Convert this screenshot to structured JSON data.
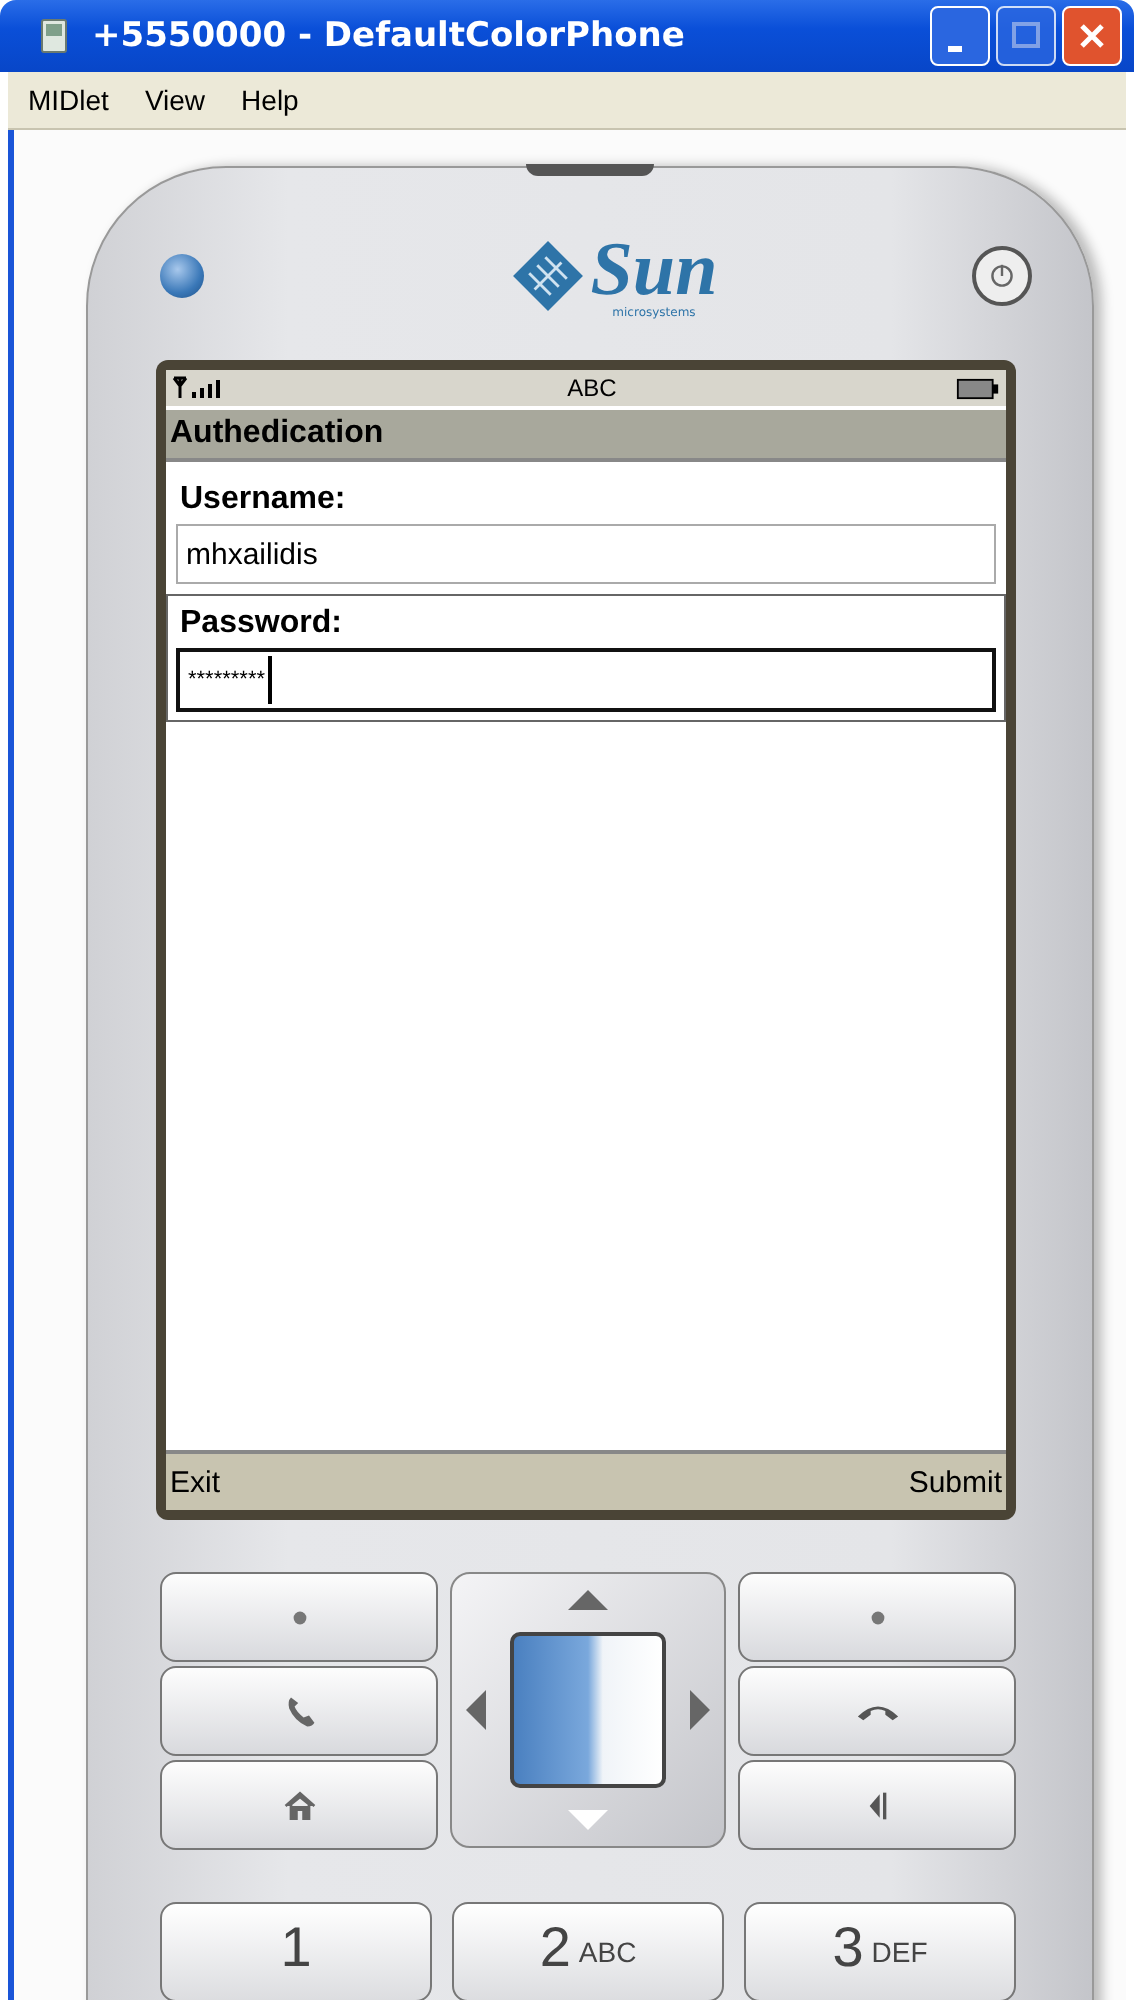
{
  "window": {
    "title": "+5550000 - DefaultColorPhone"
  },
  "menu": [
    "MIDlet",
    "View",
    "Help"
  ],
  "logo": {
    "name": "Sun",
    "tagline": "microsystems"
  },
  "status_bar": {
    "input_mode": "ABC"
  },
  "screen": {
    "title": "Authedication",
    "fields": [
      {
        "label": "Username:",
        "value": "mhxailidis",
        "focused": false
      },
      {
        "label": "Password:",
        "value": "*********",
        "focused": true
      }
    ]
  },
  "soft_keys": {
    "left": "Exit",
    "right": "Submit"
  },
  "number_keys": [
    {
      "digit": "1"
    },
    {
      "digit": "2",
      "letters": "ABC"
    },
    {
      "digit": "3",
      "letters": "DEF"
    }
  ]
}
